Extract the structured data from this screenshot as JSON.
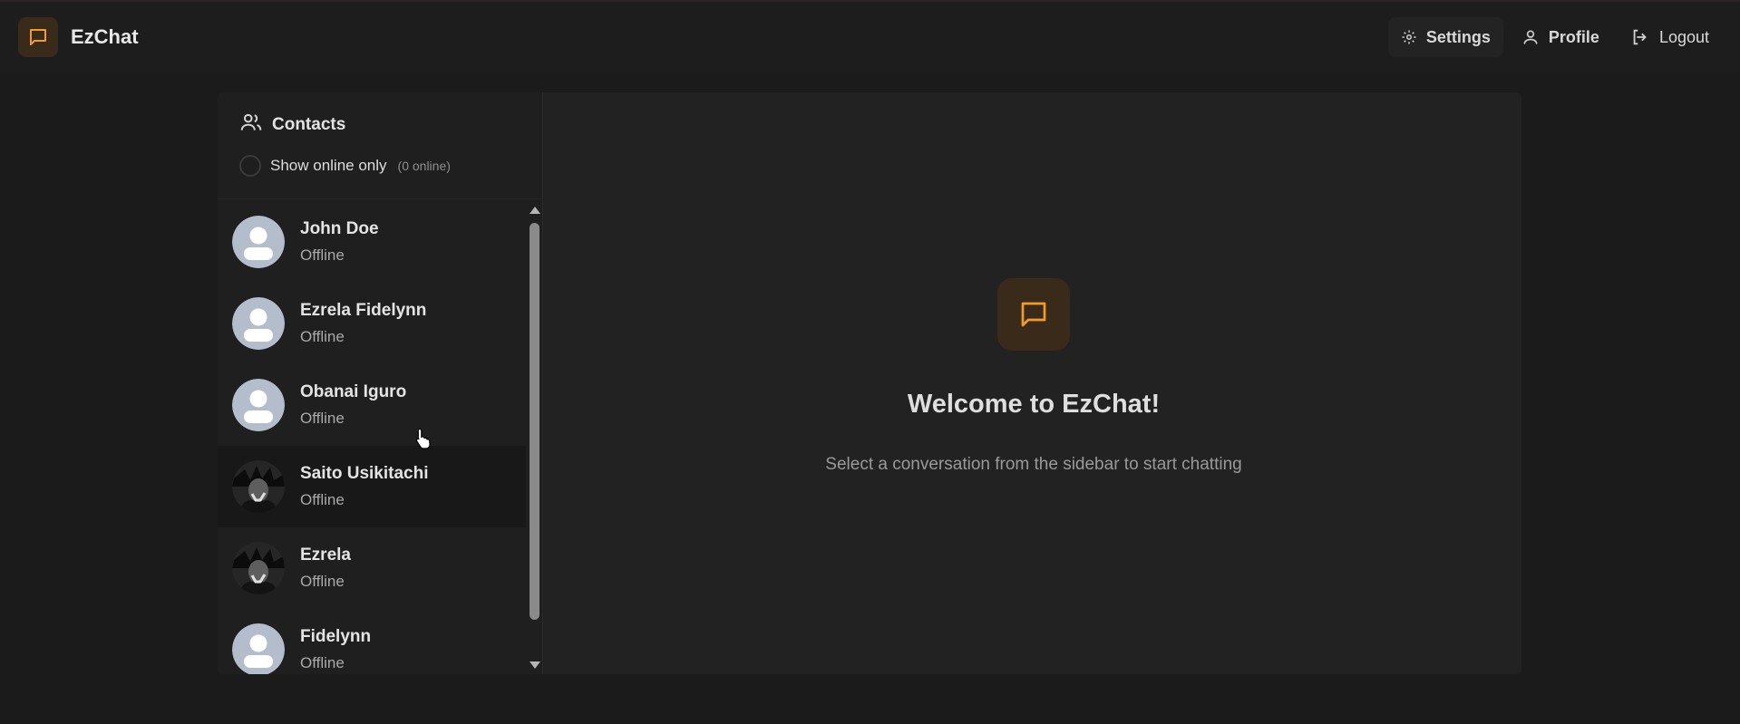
{
  "app": {
    "name": "EzChat",
    "accent": "#f29b2c"
  },
  "navbar": {
    "settings_label": "Settings",
    "profile_label": "Profile",
    "logout_label": "Logout"
  },
  "sidebar": {
    "title": "Contacts",
    "filter_label": "Show online only",
    "online_count": "(0 online)",
    "contacts": [
      {
        "name": "John Doe",
        "status": "Offline",
        "avatar": "default"
      },
      {
        "name": "Ezrela Fidelynn",
        "status": "Offline",
        "avatar": "default"
      },
      {
        "name": "Obanai Iguro",
        "status": "Offline",
        "avatar": "default"
      },
      {
        "name": "Saito Usikitachi",
        "status": "Offline",
        "avatar": "photo"
      },
      {
        "name": "Ezrela",
        "status": "Offline",
        "avatar": "photo"
      },
      {
        "name": "Fidelynn",
        "status": "Offline",
        "avatar": "default"
      }
    ]
  },
  "welcome": {
    "title": "Welcome to EzChat!",
    "subtitle": "Select a conversation from the sidebar to start chatting"
  }
}
